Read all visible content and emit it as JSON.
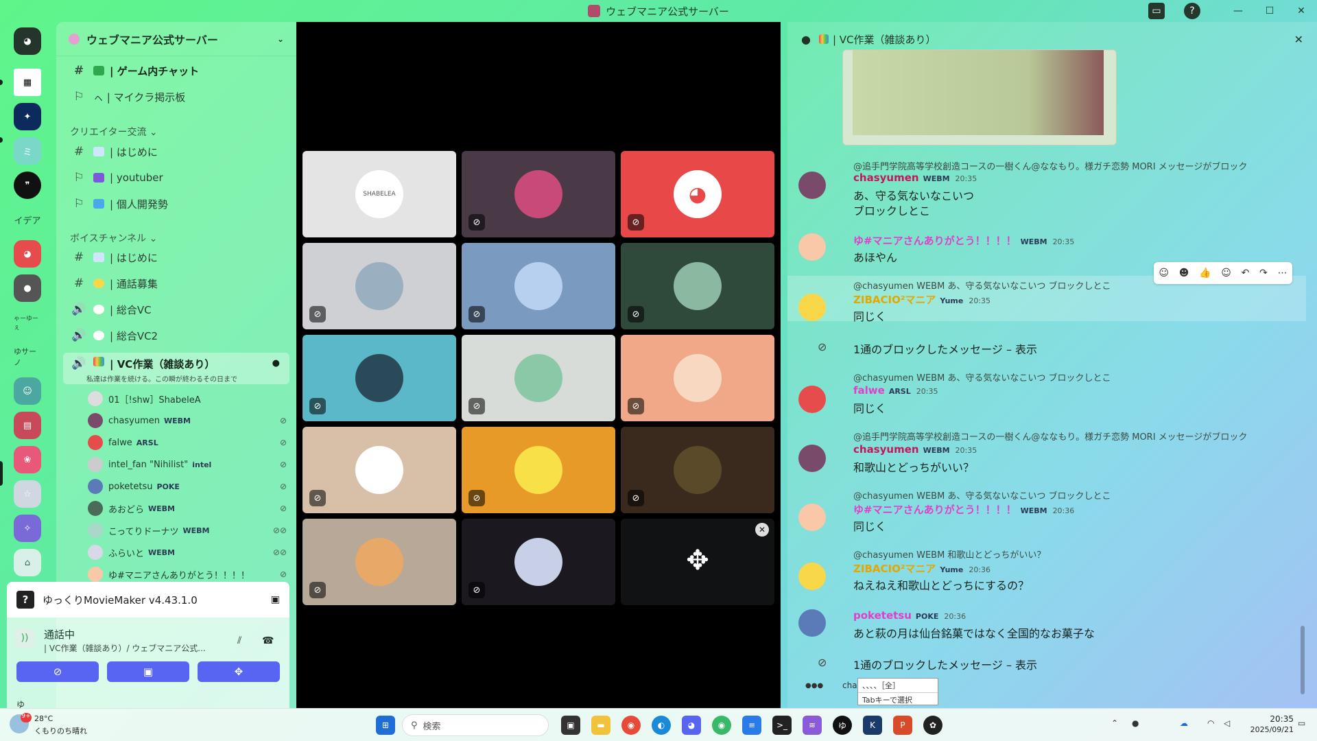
{
  "window": {
    "title": "ウェブマニア公式サーバー"
  },
  "rail": {
    "servers": [
      "discord-home",
      "qr",
      "blue-glow",
      "miku",
      "quote",
      "イデア",
      "discord-red",
      "avatar-dark",
      "ゆ〜",
      "ゆサーノ",
      "character",
      "collage",
      "anime-girl",
      "white-hair",
      "purple",
      "cake"
    ],
    "labels": {
      "idea": "イデア",
      "yu": "ゃーゆーぇ",
      "yus": "ゆサーノ"
    }
  },
  "sidebar": {
    "guild_name": "ウェブマニア公式サーバー",
    "top_channels": [
      {
        "label": "| ゲーム内チャット",
        "sym": "#"
      },
      {
        "label": "ㇸ | マイクラ掲示板",
        "sym": "⚐"
      }
    ],
    "cat_creator": "クリエイター交流 ⌄",
    "creator_channels": [
      {
        "label": "| はじめに",
        "sym": "#"
      },
      {
        "label": "| youtuber",
        "sym": "⚐"
      },
      {
        "label": "| 個人開発勢",
        "sym": "⚐"
      }
    ],
    "cat_voice": "ボイスチャンネル ⌄",
    "voice_channels": [
      {
        "label": "| はじめに",
        "sym": "#"
      },
      {
        "label": "| 通話募集",
        "sym": "#"
      },
      {
        "label": "| 総合VC",
        "sym": "🔊"
      },
      {
        "label": "| 総合VC2",
        "sym": "🔊"
      }
    ],
    "active_vc": {
      "label": "| VC作業（雑談あり）",
      "status": "私達は作業を続ける。この瞬が終わるその日まで"
    },
    "members": [
      {
        "name": "01［!shw］ShabeleA",
        "tag": ""
      },
      {
        "name": "chasyumen",
        "tag": "WEBM"
      },
      {
        "name": "falwe",
        "tag": "ARSL"
      },
      {
        "name": "intel_fan \"Nihilist\"",
        "tag": "intel"
      },
      {
        "name": "poketetsu",
        "tag": "POKE"
      },
      {
        "name": "あおどら",
        "tag": "WEBM"
      },
      {
        "name": "こってりドーナツ",
        "tag": "WEBM"
      },
      {
        "name": "ふらいと",
        "tag": "WEBM"
      },
      {
        "name": "ゆ#マニアさんありがとう！！！！",
        "tag": ""
      }
    ]
  },
  "activity": {
    "name": "ゆっくりMovieMaker v4.43.1.0"
  },
  "voice": {
    "status": "通話中",
    "channel": "| VC作業（雑談あり）/ ウェブマニア公式...",
    "user": "ゆ"
  },
  "chat": {
    "header": "| VC作業（雑談あり）",
    "messages": [
      {
        "reply": "@追手門学院高等学校創造コースの一樹くん@ななもり。様ガチ恋勢 MORI メッセージがブロック",
        "user": "chasyumen",
        "tag": "WEBM",
        "time": "20:35",
        "lines": [
          "あ、守る気ないなこいつ",
          "ブロックしとこ"
        ],
        "color": "#c2185b"
      },
      {
        "reply": "",
        "user": "ゆ#マニアさんありがとう！！！！",
        "tag": "WEBM",
        "time": "20:35",
        "lines": [
          "あほやん"
        ],
        "color": "#e040c8"
      },
      {
        "reply": "@chasyumen WEBM あ、守る気ないなこいつ ブロックしとこ",
        "user": "ZIBACIO²マニア",
        "tag": "Yume",
        "time": "20:35",
        "lines": [
          "同じく"
        ],
        "color": "#e6a600"
      },
      {
        "blocked": "1通のブロックしたメッセージ – 表示"
      },
      {
        "reply": "@chasyumen WEBM あ、守る気ないなこいつ ブロックしとこ",
        "user": "falwe",
        "tag": "ARSL",
        "time": "20:35",
        "lines": [
          "同じく"
        ],
        "color": "#e040c8"
      },
      {
        "reply": "@追手門学院高等学校創造コースの一樹くん@ななもり。様ガチ恋勢 MORI メッセージがブロック",
        "user": "chasyumen",
        "tag": "WEBM",
        "time": "20:35",
        "lines": [
          "和歌山とどっちがいい？"
        ],
        "color": "#c2185b"
      },
      {
        "reply": "@chasyumen WEBM あ、守る気ないなこいつ ブロックしとこ",
        "user": "ゆ#マニアさんありがとう！！！！",
        "tag": "WEBM",
        "time": "20:36",
        "lines": [
          "同じく"
        ],
        "color": "#e040c8"
      },
      {
        "reply": "@chasyumen WEBM 和歌山とどっちがいい？",
        "user": "ZIBACIO²マニア",
        "tag": "Yume",
        "time": "20:36",
        "lines": [
          "ねえねえ和歌山とどっちにするの？"
        ],
        "color": "#e6a600"
      },
      {
        "reply": "",
        "user": "poketetsu",
        "tag": "POKE",
        "time": "20:36",
        "lines": [
          "あと萩の月は仙台銘菓ではなく全国的なお菓子な"
        ],
        "color": "#e040c8"
      },
      {
        "blocked": "1通のブロックしたメッセージ – 表示"
      }
    ],
    "typing": "chas",
    "ime_candidate": "、、、、［全］",
    "ime_hint": "Tabキーで選択"
  },
  "taskbar": {
    "weather_temp": "28°C",
    "weather_desc": "くもりのち晴れ",
    "weather_badge": "9+",
    "search_placeholder": "検索",
    "time": "20:35",
    "date": "2025/09/21"
  },
  "tile_shabelea": "SHABELEA"
}
